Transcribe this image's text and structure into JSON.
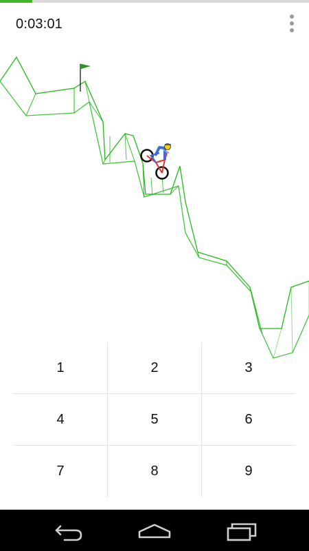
{
  "progress": {
    "fraction": 0.105
  },
  "timer": {
    "text": "0:03:01"
  },
  "menu": {
    "icon": "overflow-menu-icon"
  },
  "track": {
    "color": "#22b81a"
  },
  "rider": {
    "icon": "bmx-rider-icon",
    "frame_color": "#e23030",
    "jersey_color": "#3b6fd6",
    "helmet_color": "#f4d21a"
  },
  "finish_flag": {
    "icon": "finish-flag-icon"
  },
  "keypad": {
    "keys": [
      "1",
      "2",
      "3",
      "4",
      "5",
      "6",
      "7",
      "8",
      "9"
    ]
  },
  "navbar": {
    "back": "back-icon",
    "home": "home-icon",
    "recents": "recents-icon"
  }
}
